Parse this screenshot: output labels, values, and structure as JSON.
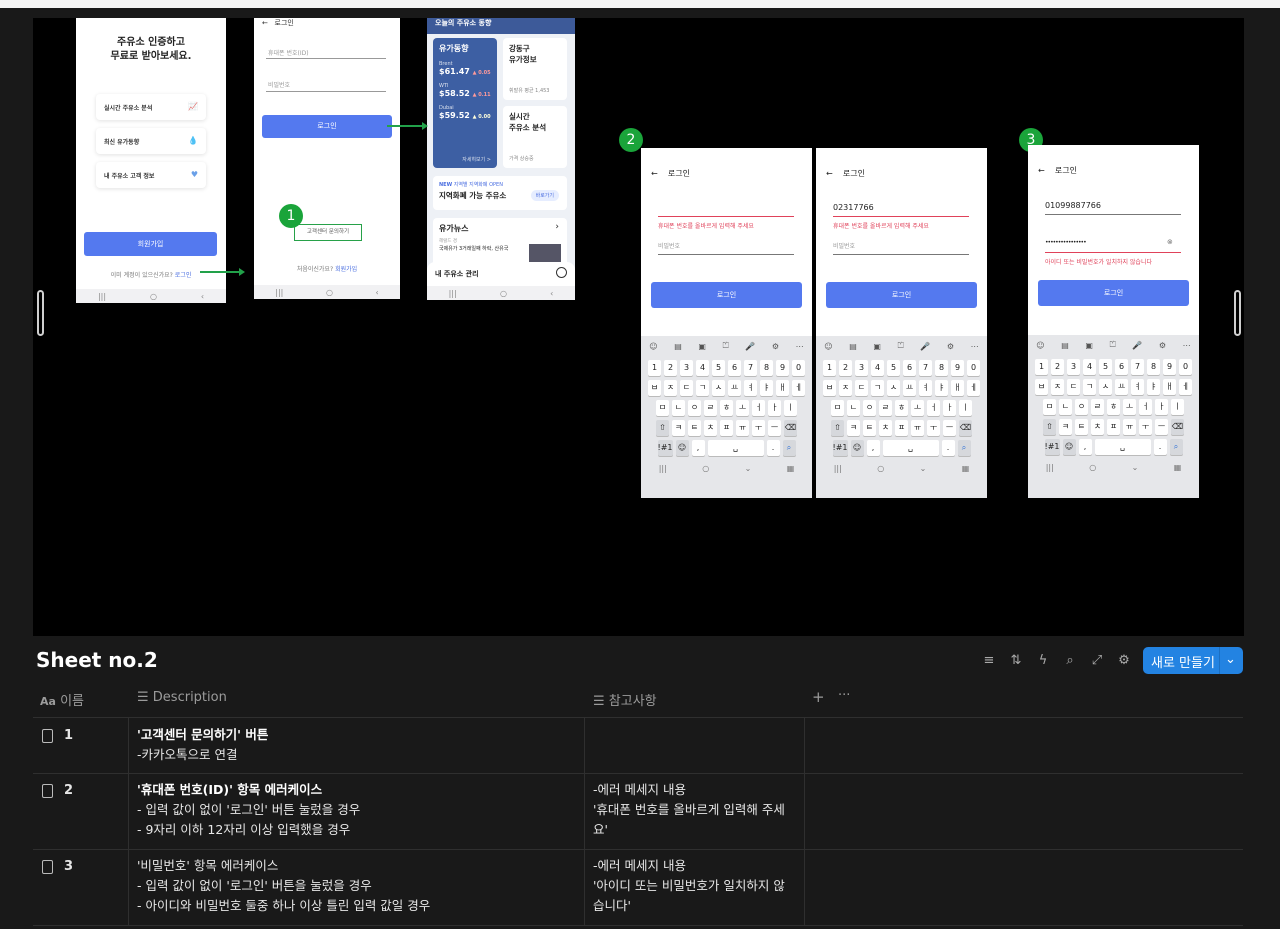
{
  "phones": {
    "p1": {
      "title_line1": "주유소 인증하고",
      "title_line2": "무료로 받아보세요.",
      "cards": [
        "실시간 주유소 분석",
        "최신 유가동향",
        "내 주유소 고객 정보"
      ],
      "signup": "회원가입",
      "has_account": "이미 계정이 있으신가요?",
      "login_link": "로그인"
    },
    "p2": {
      "header": "로그인",
      "id_placeholder": "휴대폰 번호(ID)",
      "pw_placeholder": "비밀번호",
      "login": "로그인",
      "cs_link": "고객센터 문의하기",
      "first_time": "처음이신가요?",
      "join": "회원가입"
    },
    "p3": {
      "header": "오늘의 주유소 동향",
      "trend_title": "유가동향",
      "brent_label": "Brent",
      "brent": "$61.47",
      "brent_chg": "▲ 0.05",
      "wti_label": "WTI",
      "wti": "$58.52",
      "wti_chg": "▲ 0.11",
      "dubai_label": "Dubai",
      "dubai": "$59.52",
      "dubai_chg": "▲ 0.00",
      "detail": "자세히보기 >",
      "gangdong": "강동구",
      "gangdong2": "유가정보",
      "avg": "휘발유 평균 1,453",
      "realtime": "실시간",
      "realtime2": "주유소 분석",
      "price_up": "가격 상승중",
      "banner_new": "NEW",
      "banner_sub": "지역별 지역화폐 OPEN",
      "banner_title": "지역화폐 가능 주유소",
      "banner_btn": "바로가기",
      "news": "유가뉴스",
      "news_src": "헤럴드 경",
      "news_text": "국제유가 3거래일째 하락, 산유국",
      "bottom": "내 주유소 관리"
    },
    "e2a": {
      "header": "로그인",
      "error": "휴대폰 번호를 올바르게 입력해 주세요",
      "pw": "비밀번호",
      "login": "로그인"
    },
    "e2b": {
      "header": "로그인",
      "value": "02317766",
      "error": "휴대폰 번호를 올바르게 입력해 주세요",
      "pw": "비밀번호",
      "login": "로그인"
    },
    "e3": {
      "header": "로그인",
      "value": "01099887766",
      "pw_dots": "••••••••••••••••",
      "error": "아이디 또는 비밀번호가 일치하지 않습니다",
      "login": "로그인"
    }
  },
  "keyboard": {
    "nums": [
      "1",
      "2",
      "3",
      "4",
      "5",
      "6",
      "7",
      "8",
      "9",
      "0"
    ],
    "row1": [
      "ㅂ",
      "ㅈ",
      "ㄷ",
      "ㄱ",
      "ㅅ",
      "ㅛ",
      "ㅕ",
      "ㅑ",
      "ㅐ",
      "ㅔ"
    ],
    "row2": [
      "ㅁ",
      "ㄴ",
      "ㅇ",
      "ㄹ",
      "ㅎ",
      "ㅗ",
      "ㅓ",
      "ㅏ",
      "ㅣ"
    ],
    "row3": [
      "ㅋ",
      "ㅌ",
      "ㅊ",
      "ㅍ",
      "ㅠ",
      "ㅜ",
      "ㅡ"
    ],
    "sym": "!#1"
  },
  "badges": [
    "1",
    "2",
    "3"
  ],
  "sheet": {
    "title": "Sheet no.2",
    "new_button": "새로 만들기",
    "columns": {
      "name": "이름",
      "description": "Description",
      "notes": "참고사항"
    },
    "rows": [
      {
        "id": "1",
        "d1": "'고객센터 문의하기' 버튼",
        "d2": "-카카오톡으로 연결",
        "d3": "",
        "n1": "",
        "n2": ""
      },
      {
        "id": "2",
        "d1": "'휴대폰 번호(ID)' 항목 에러케이스",
        "d2": "- 입력 값이 없이 '로그인' 버튼 눌렀을 경우",
        "d3": "- 9자리 이하 12자리 이상 입력했을 경우",
        "n1": "-에러 메세지 내용",
        "n2": "'휴대폰 번호를 올바르게 입력해 주세",
        "n3": "요'"
      },
      {
        "id": "3",
        "d1": "'비밀번호' 항목 에러케이스",
        "d2": "- 입력 값이 없이 '로그인' 버튼을 눌렀을 경우",
        "d3": "- 아이디와 비밀번호 둘중 하나 이상 틀린 입력 값일 경우",
        "n1": "-에러 메세지 내용",
        "n2": "'아이디 또는 비밀번호가 일치하지 않",
        "n3": "습니다'"
      }
    ]
  }
}
